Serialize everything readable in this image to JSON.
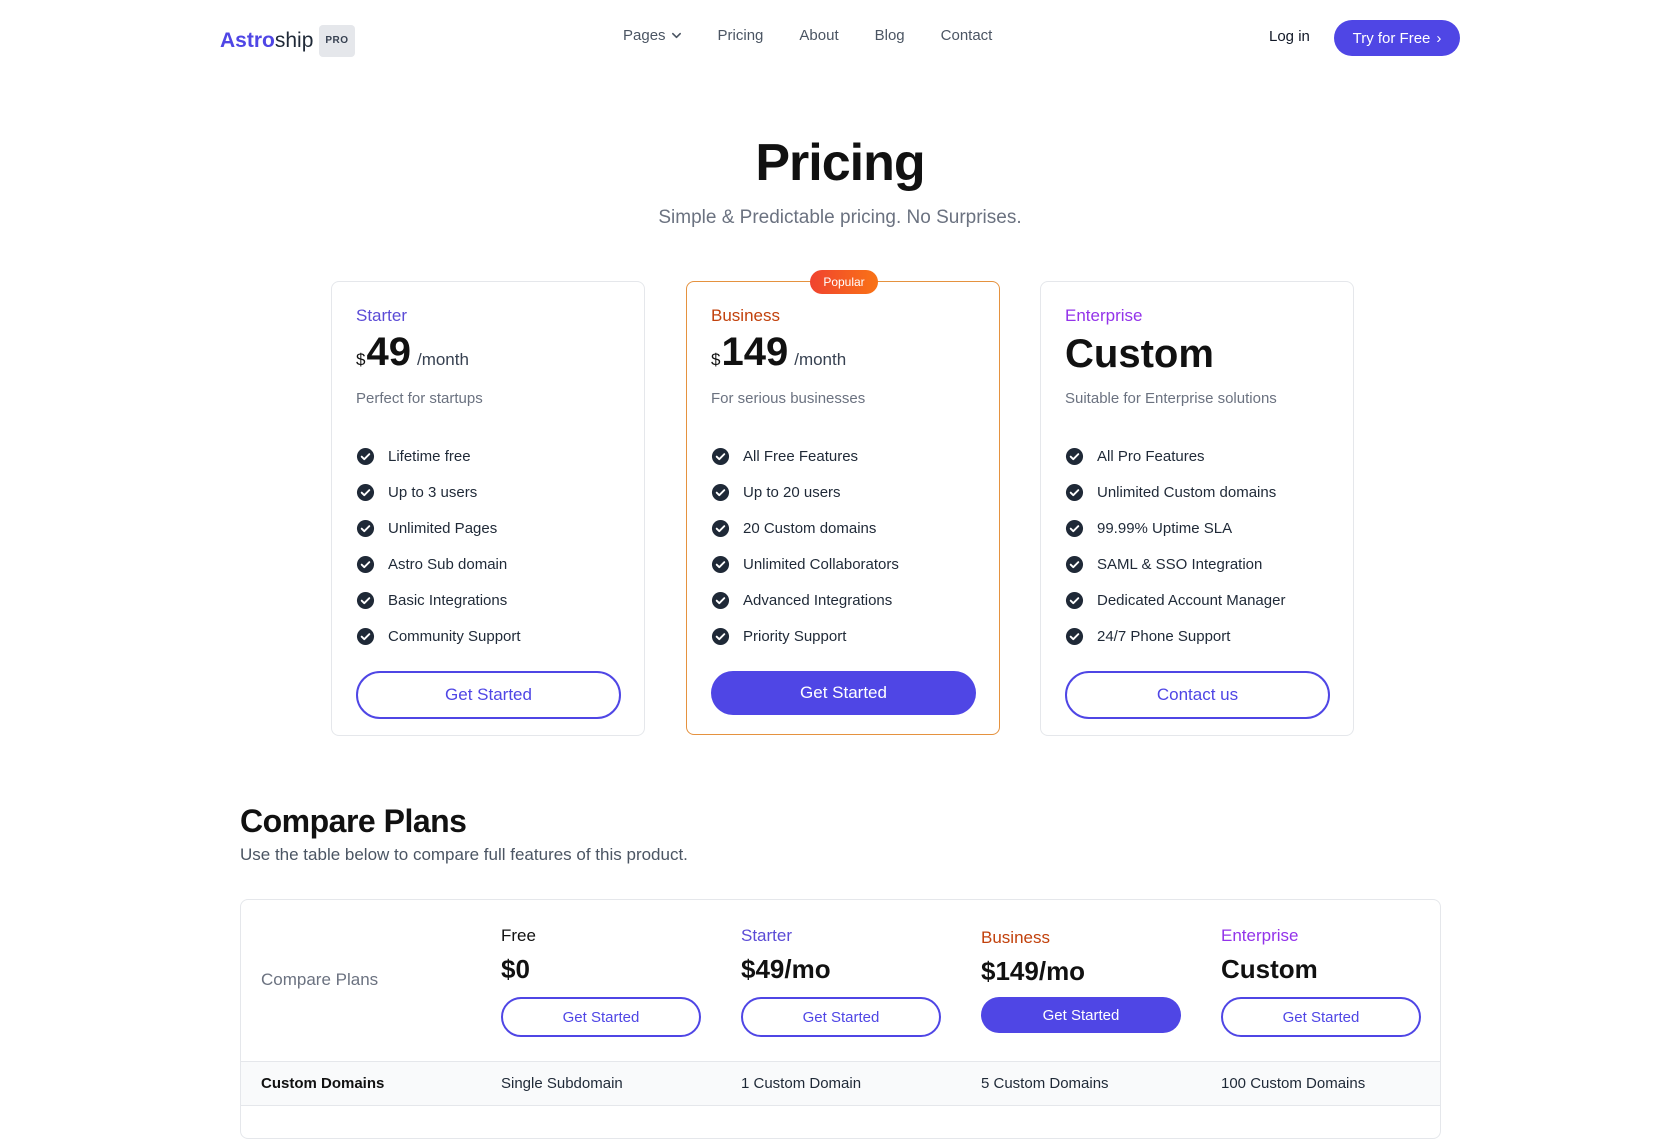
{
  "header": {
    "logo_primary": "Astro",
    "logo_secondary": "ship",
    "logo_badge": "PRO",
    "nav": [
      "Pages",
      "Pricing",
      "About",
      "Blog",
      "Contact"
    ],
    "login": "Log in",
    "cta": "Try for Free"
  },
  "hero": {
    "title": "Pricing",
    "subtitle": "Simple & Predictable pricing. No Surprises."
  },
  "colors": {
    "accent": "#4f46e5",
    "starter": "#5b4bd6",
    "business": "#c2410c",
    "enterprise": "#9333ea",
    "popular_border": "#e5923f"
  },
  "plans": [
    {
      "name": "Starter",
      "currency": "$",
      "price": "49",
      "period": "/month",
      "description": "Perfect for startups",
      "features": [
        "Lifetime free",
        "Up to 3 users",
        "Unlimited Pages",
        "Astro Sub domain",
        "Basic Integrations",
        "Community Support"
      ],
      "button": "Get Started"
    },
    {
      "name": "Business",
      "badge": "Popular",
      "currency": "$",
      "price": "149",
      "period": "/month",
      "description": "For serious businesses",
      "features": [
        "All Free Features",
        "Up to 20 users",
        "20 Custom domains",
        "Unlimited Collaborators",
        "Advanced Integrations",
        "Priority Support"
      ],
      "button": "Get Started"
    },
    {
      "name": "Enterprise",
      "price": "Custom",
      "description": "Suitable for Enterprise solutions",
      "features": [
        "All Pro Features",
        "Unlimited Custom domains",
        "99.99% Uptime SLA",
        "SAML & SSO Integration",
        "Dedicated Account Manager",
        "24/7 Phone Support"
      ],
      "button": "Contact us"
    }
  ],
  "compare": {
    "title": "Compare Plans",
    "subtitle": "Use the table below to compare full features of this product.",
    "table_label": "Compare Plans",
    "columns": [
      {
        "name": "Free",
        "price": "$0",
        "button": "Get Started"
      },
      {
        "name": "Starter",
        "price": "$49/mo",
        "button": "Get Started"
      },
      {
        "name": "Business",
        "price": "$149/mo",
        "button": "Get Started"
      },
      {
        "name": "Enterprise",
        "price": "Custom",
        "button": "Get Started"
      }
    ],
    "rows": [
      {
        "feature": "Custom Domains",
        "values": [
          "Single Subdomain",
          "1 Custom Domain",
          "5 Custom Domains",
          "100 Custom Domains"
        ]
      }
    ]
  }
}
